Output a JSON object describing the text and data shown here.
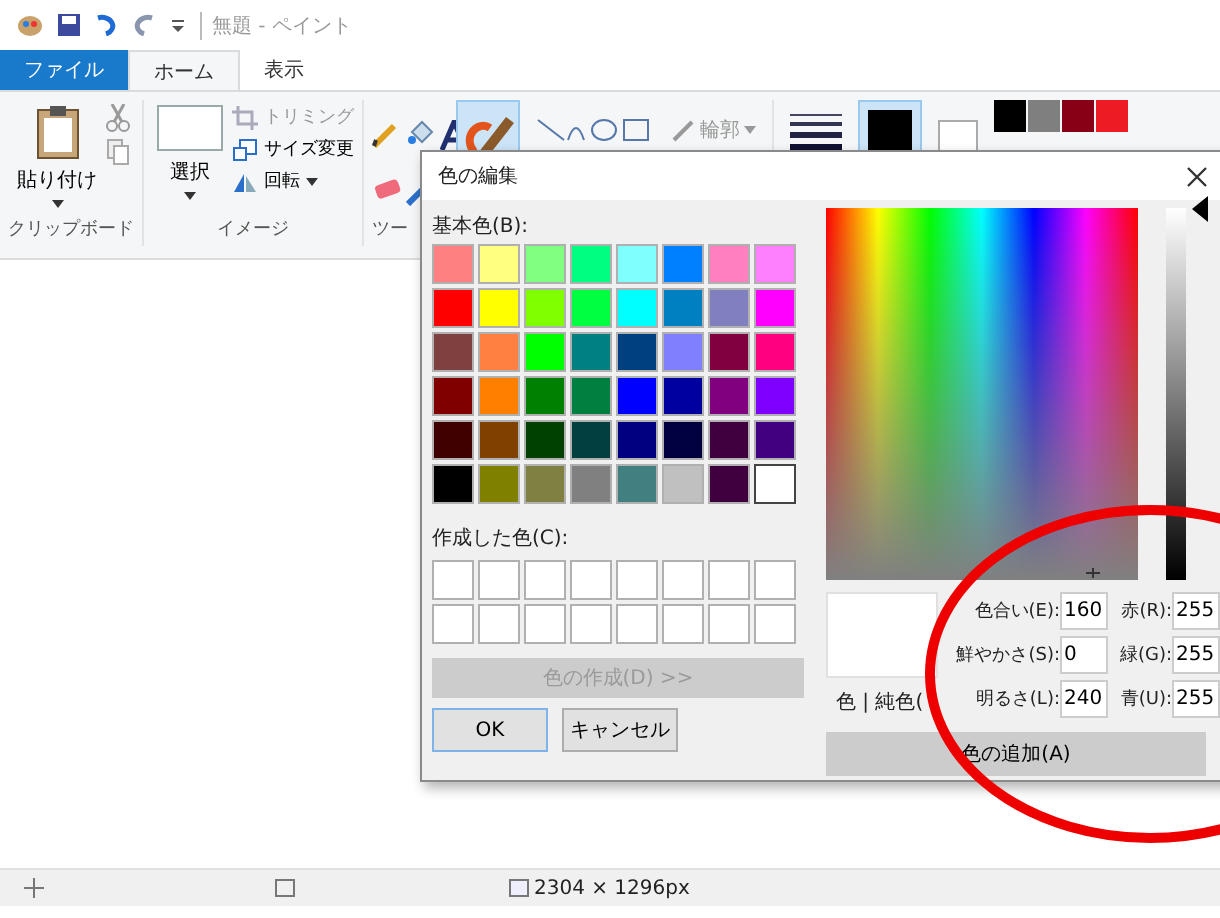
{
  "window": {
    "title": "無題 - ペイント"
  },
  "tabs": [
    {
      "label": "ファイル",
      "kind": "file",
      "selected": false
    },
    {
      "label": "ホーム",
      "kind": "tab",
      "selected": true
    },
    {
      "label": "表示",
      "kind": "tab",
      "selected": false
    }
  ],
  "ribbon": {
    "clipboard": {
      "paste": "貼り付け",
      "label": "クリップボード"
    },
    "image": {
      "select": "選択",
      "items": [
        "トリミング",
        "サイズ変更",
        "回転"
      ],
      "label": "イメージ"
    },
    "tools": {
      "label": "ツー"
    },
    "outline": "輪郭",
    "palette": [
      {
        "color": "#000000"
      },
      {
        "color": "#7f7f7f"
      },
      {
        "color": "#880015"
      },
      {
        "color": "#ed1c24"
      }
    ]
  },
  "status_bar": {
    "size": "2304 × 1296px"
  },
  "dialog": {
    "title": "色の編集",
    "basic_label": "基本色(B):",
    "basic_colors": [
      {
        "color": "#ff8080",
        "selected": false
      },
      {
        "color": "#ffff80",
        "selected": false
      },
      {
        "color": "#80ff80",
        "selected": false
      },
      {
        "color": "#00ff80",
        "selected": false
      },
      {
        "color": "#80ffff",
        "selected": false
      },
      {
        "color": "#0080ff",
        "selected": false
      },
      {
        "color": "#ff80c0",
        "selected": false
      },
      {
        "color": "#ff80ff",
        "selected": false
      },
      {
        "color": "#ff0000",
        "selected": false
      },
      {
        "color": "#ffff00",
        "selected": false
      },
      {
        "color": "#80ff00",
        "selected": false
      },
      {
        "color": "#00ff40",
        "selected": false
      },
      {
        "color": "#00ffff",
        "selected": false
      },
      {
        "color": "#0080c0",
        "selected": false
      },
      {
        "color": "#8080c0",
        "selected": false
      },
      {
        "color": "#ff00ff",
        "selected": false
      },
      {
        "color": "#804040",
        "selected": false
      },
      {
        "color": "#ff8040",
        "selected": false
      },
      {
        "color": "#00ff00",
        "selected": false
      },
      {
        "color": "#008080",
        "selected": false
      },
      {
        "color": "#004080",
        "selected": false
      },
      {
        "color": "#8080ff",
        "selected": false
      },
      {
        "color": "#800040",
        "selected": false
      },
      {
        "color": "#ff0080",
        "selected": false
      },
      {
        "color": "#800000",
        "selected": false
      },
      {
        "color": "#ff8000",
        "selected": false
      },
      {
        "color": "#008000",
        "selected": false
      },
      {
        "color": "#008040",
        "selected": false
      },
      {
        "color": "#0000ff",
        "selected": false
      },
      {
        "color": "#0000a0",
        "selected": false
      },
      {
        "color": "#800080",
        "selected": false
      },
      {
        "color": "#8000ff",
        "selected": false
      },
      {
        "color": "#400000",
        "selected": false
      },
      {
        "color": "#804000",
        "selected": false
      },
      {
        "color": "#004000",
        "selected": false
      },
      {
        "color": "#004040",
        "selected": false
      },
      {
        "color": "#000080",
        "selected": false
      },
      {
        "color": "#000040",
        "selected": false
      },
      {
        "color": "#400040",
        "selected": false
      },
      {
        "color": "#400080",
        "selected": false
      },
      {
        "color": "#000000",
        "selected": false
      },
      {
        "color": "#808000",
        "selected": false
      },
      {
        "color": "#808040",
        "selected": false
      },
      {
        "color": "#808080",
        "selected": false
      },
      {
        "color": "#408080",
        "selected": false
      },
      {
        "color": "#c0c0c0",
        "selected": false
      },
      {
        "color": "#400040",
        "selected": false
      },
      {
        "color": "#ffffff",
        "selected": true
      }
    ],
    "custom_label": "作成した色(C):",
    "custom_colors": [
      {
        "color": "#ffffff"
      },
      {
        "color": "#ffffff"
      },
      {
        "color": "#ffffff"
      },
      {
        "color": "#ffffff"
      },
      {
        "color": "#ffffff"
      },
      {
        "color": "#ffffff"
      },
      {
        "color": "#ffffff"
      },
      {
        "color": "#ffffff"
      },
      {
        "color": "#ffffff"
      },
      {
        "color": "#ffffff"
      },
      {
        "color": "#ffffff"
      },
      {
        "color": "#ffffff"
      },
      {
        "color": "#ffffff"
      },
      {
        "color": "#ffffff"
      },
      {
        "color": "#ffffff"
      },
      {
        "color": "#ffffff"
      }
    ],
    "define_button": {
      "label": "色の作成(D) >>",
      "disabled": true
    },
    "ok": "OK",
    "cancel": "キャンセル",
    "preview_label": "色 | 純色(",
    "hsl": [
      {
        "label": "色合い(E):",
        "value": "160"
      },
      {
        "label": "鮮やかさ(S):",
        "value": "0"
      },
      {
        "label": "明るさ(L):",
        "value": "240"
      }
    ],
    "rgb": [
      {
        "label": "赤(R):",
        "value": "255"
      },
      {
        "label": "緑(G):",
        "value": "255"
      },
      {
        "label": "青(U):",
        "value": "255"
      }
    ],
    "add_button": "色の追加(A)"
  }
}
